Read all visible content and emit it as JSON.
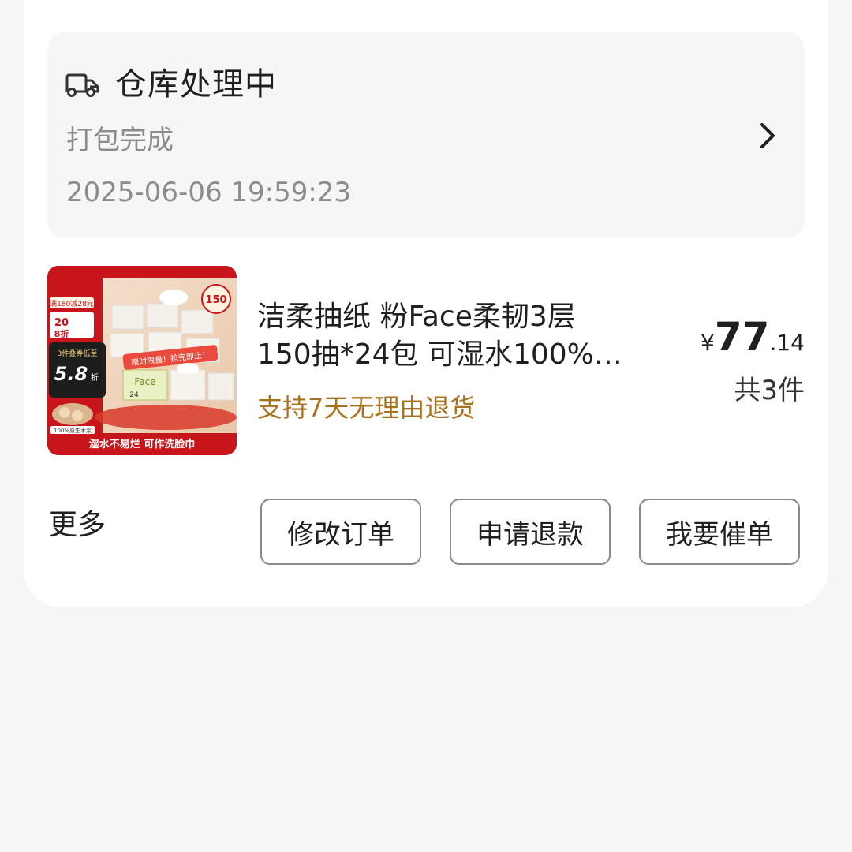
{
  "logistics": {
    "icon": "truck-icon",
    "status": "仓库处理中",
    "detail": "打包完成",
    "time": "2025-06-06 19:59:23"
  },
  "product": {
    "title_line1": "洁柔抽纸 粉Face柔韧3层",
    "title_line2": "150抽*24包 可湿水100%…",
    "return_policy": "支持7天无理由退货",
    "price_currency": "¥",
    "price_integer": "77",
    "price_decimal": ".14",
    "quantity": "共3件",
    "image": {
      "promo_top": "满180减28元",
      "promo_badge": "20",
      "promo_discount": "8折",
      "deal_label": "3件叠券低至",
      "deal_value": "5.8",
      "deal_unit": "折",
      "limited": "限时限量！抢完即止！",
      "count_badge": "150",
      "fiber": "100%原生木浆",
      "bottom_banner": "湿水不易烂  可作洗脸巾",
      "brand": "Face",
      "box_count": "24",
      "colors": {
        "red": "#c8151c",
        "dark_red": "#8f0d12",
        "gold": "#f3d27a"
      }
    }
  },
  "actions": {
    "more": "更多",
    "modify": "修改订单",
    "refund": "申请退款",
    "urge": "我要催单"
  }
}
